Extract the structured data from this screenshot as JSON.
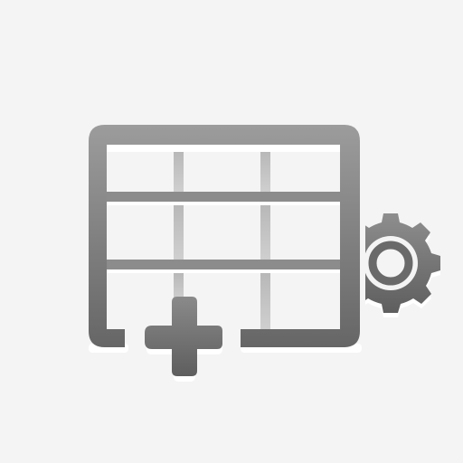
{
  "icon": {
    "name": "insert-table-with-settings",
    "parts": [
      "table-grid-icon",
      "plus-icon",
      "gear-icon"
    ]
  },
  "colors": {
    "background": "#f4f4f4",
    "frame_dark": "#6b6b6b",
    "frame_light": "#9a9a9a",
    "grid_line": "#8c8c8c",
    "grid_line_light": "#c4c4c4",
    "highlight": "#ffffff"
  }
}
